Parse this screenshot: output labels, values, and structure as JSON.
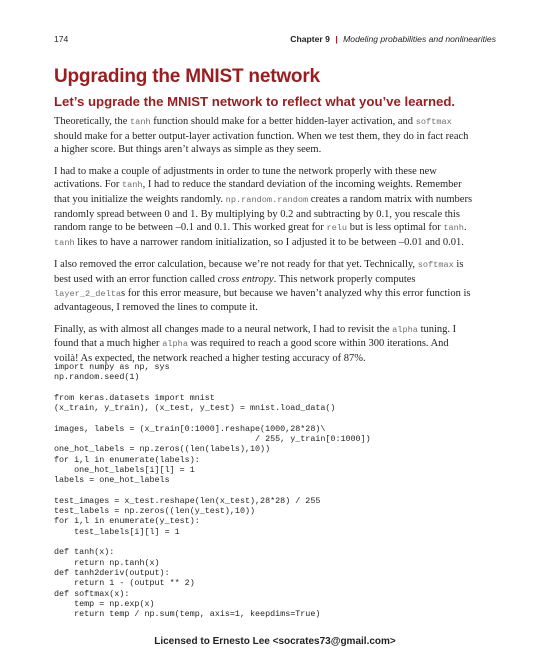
{
  "header": {
    "page_number": "174",
    "chapter_label": "Chapter 9",
    "separator": "|",
    "chapter_title": "Modeling probabilities and nonlinearities"
  },
  "section_title": "Upgrading the MNIST network",
  "subtitle": "Let’s upgrade the MNIST network to reflect what you’ve learned.",
  "paragraphs": {
    "p1": {
      "a": "Theoretically, the ",
      "c1": "tanh",
      "b": " function should make for a better hidden-layer activation, and ",
      "c2": "softmax",
      "c": " should make for a better output-layer activation function. When we test them, they do in fact reach a higher score. But things aren’t always as simple as they seem."
    },
    "p2": {
      "a": "I had to make a couple of adjustments in order to tune the network properly with these new activations. For ",
      "c1": "tanh",
      "b": ", I had to reduce the standard deviation of the incoming weights. Remember that you initialize the weights randomly. ",
      "c2": "np.random.random",
      "c": " creates a random matrix with numbers randomly spread between 0 and 1. By multiplying by 0.2 and subtracting by 0.1, you rescale this random range to be between –0.1 and 0.1. This worked great for ",
      "c3": "relu",
      "d": " but is less optimal for ",
      "c4": "tanh",
      "e": ". ",
      "c5": "tanh",
      "f": " likes to have a narrower random initialization, so I adjusted it to be between –0.01 and 0.01."
    },
    "p3": {
      "a": "I also removed the error calculation, because we’re not ready for that yet. Technically, ",
      "c1": "softmax",
      "b": " is best used with an error function called ",
      "em": "cross entropy",
      "c": ". This network properly computes ",
      "c2": "layer_2_delta",
      "d": "s for this error measure, but because we haven’t analyzed why this error function is advantageous, I removed the lines to compute it."
    },
    "p4": {
      "a": "Finally, as with almost all changes made to a neural network, I had to revisit the ",
      "c1": "alpha",
      "b": " tuning. I found that a much higher ",
      "c2": "alpha",
      "c": " was required to reach a good score within 300 iterations. And voilà! As expected, the network reached a higher testing accuracy of 87%."
    }
  },
  "code": "import numpy as np, sys\nnp.random.seed(1)\n\nfrom keras.datasets import mnist\n(x_train, y_train), (x_test, y_test) = mnist.load_data()\n\nimages, labels = (x_train[0:1000].reshape(1000,28*28)\\\n                                        / 255, y_train[0:1000])\none_hot_labels = np.zeros((len(labels),10))\nfor i,l in enumerate(labels):\n    one_hot_labels[i][l] = 1\nlabels = one_hot_labels\n\ntest_images = x_test.reshape(len(x_test),28*28) / 255\ntest_labels = np.zeros((len(y_test),10))\nfor i,l in enumerate(y_test):\n    test_labels[i][l] = 1\n\ndef tanh(x):\n    return np.tanh(x)\ndef tanh2deriv(output):\n    return 1 - (output ** 2)\ndef softmax(x):\n    temp = np.exp(x)\n    return temp / np.sum(temp, axis=1, keepdims=True)",
  "footer": "Licensed to Ernesto Lee <socrates73@gmail.com>"
}
